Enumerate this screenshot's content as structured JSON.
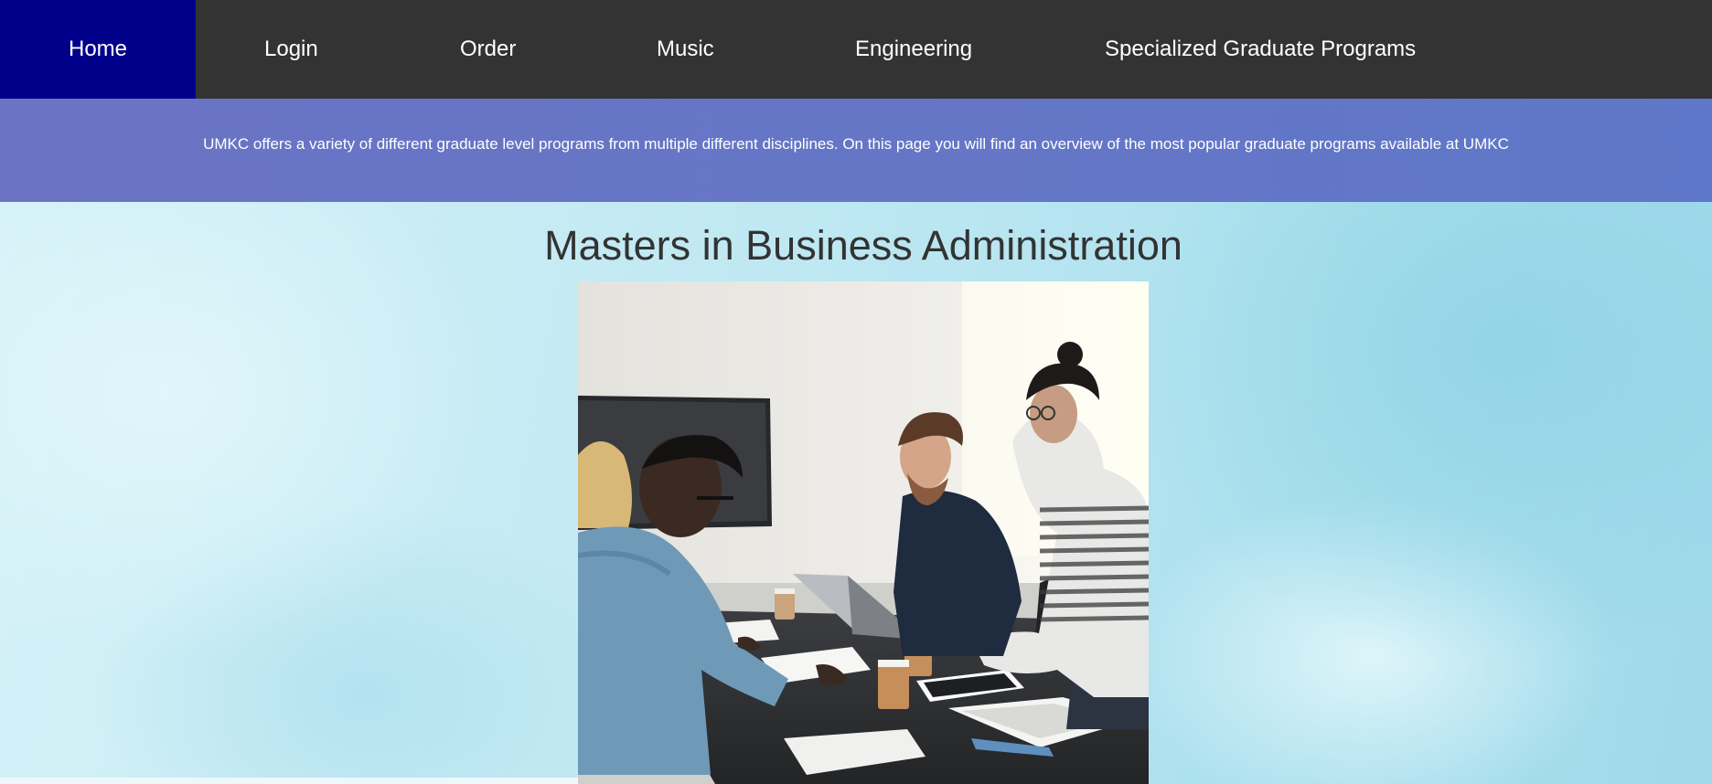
{
  "nav": {
    "items": [
      {
        "label": "Home",
        "active": true
      },
      {
        "label": "Login"
      },
      {
        "label": "Order"
      },
      {
        "label": "Music"
      },
      {
        "label": "Engineering"
      },
      {
        "label": "Specialized Graduate Programs"
      }
    ],
    "active_color": "#00008b",
    "bar_color": "#333333"
  },
  "intro": {
    "text": "UMKC offers a variety of different graduate level programs from multiple different disciplines. On this page you will find an overview of the most popular graduate programs available at UMKC"
  },
  "section": {
    "title": "Masters in Business Administration"
  }
}
